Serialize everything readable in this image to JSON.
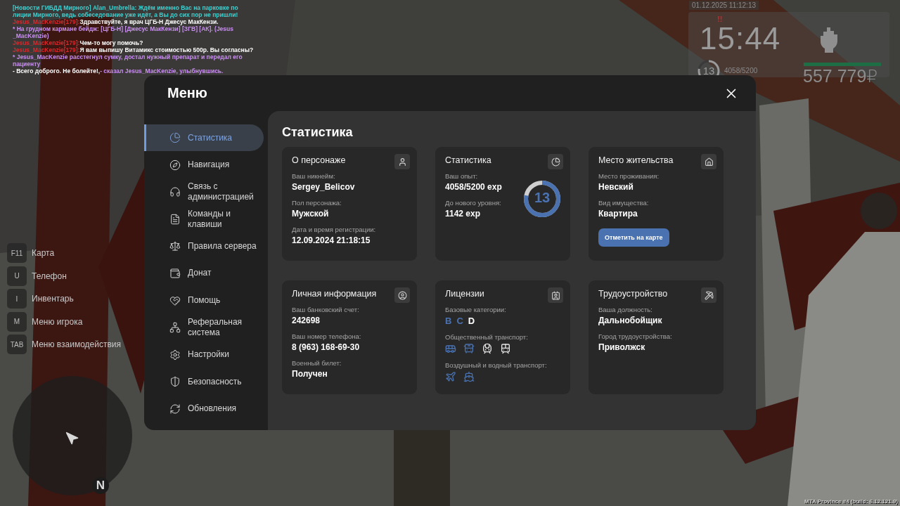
{
  "chat": [
    {
      "segments": [
        {
          "text": "[Новости ГИБДД Мирного] Alan_Umbrella: Ждём именно Вас на парковке по",
          "color": "#3fcfcf"
        }
      ]
    },
    {
      "segments": [
        {
          "text": "лиции Мирного, ведь собеседование уже идёт, а Вы до сих пор не пришли!",
          "color": "#3fcfcf"
        }
      ]
    },
    {
      "segments": [
        {
          "text": "Jesus_MacKenzie[179]:",
          "color": "#d62a2e"
        },
        {
          "text": " Здравствуйте, я врач ЦГБ-Н Джесус МакКензи.",
          "color": "#ffffff"
        }
      ]
    },
    {
      "segments": [
        {
          "text": "* На грудном кармане бейдж: [ЦГБ-Н] [Джесус МакКензи] [ЗГВ] [АК]. (Jesus",
          "color": "#c88ef0"
        }
      ]
    },
    {
      "segments": [
        {
          "text": "_MacKenzie)",
          "color": "#c88ef0"
        }
      ]
    },
    {
      "segments": [
        {
          "text": "Jesus_MacKenzie[179]:",
          "color": "#d62a2e"
        },
        {
          "text": " Чем-то могу помочь?",
          "color": "#ffffff"
        }
      ]
    },
    {
      "segments": [
        {
          "text": "Jesus_MacKenzie[179]:",
          "color": "#d62a2e"
        },
        {
          "text": " Я вам выпишу Витамикс стоимостью 500р. Вы согласны?",
          "color": "#ffffff"
        }
      ]
    },
    {
      "segments": [
        {
          "text": "* Jesus_MacKenzie расстегнул сумку, достал нужный препарат и передал его",
          "color": "#c88ef0"
        }
      ]
    },
    {
      "segments": [
        {
          "text": "пациенту",
          "color": "#c88ef0"
        }
      ]
    },
    {
      "segments": [
        {
          "text": "- Всего доброго. Не болейте!, ",
          "color": "#ffffff"
        },
        {
          "text": "- сказал Jesus_MacKenzie, улыбнувшись.",
          "color": "#c88ef0"
        }
      ]
    }
  ],
  "hud": {
    "datetime": "01.12.2025 11:12:13",
    "alert": "!!",
    "time": "15:44",
    "level": "13",
    "level_ring": {
      "level": 0.78
    },
    "experience": "4058/5200",
    "health_bar": {
      "level": 1
    },
    "money": "557 779₽"
  },
  "hotkeys": [
    {
      "key": "F11",
      "label": "Карта"
    },
    {
      "key": "U",
      "label": "Телефон"
    },
    {
      "key": "I",
      "label": "Инвентарь"
    },
    {
      "key": "M",
      "label": "Меню игрока"
    },
    {
      "key": "TAB",
      "label": "Меню взаимодействия"
    }
  ],
  "minimap": {
    "compass": "N"
  },
  "build_info": "MTA Province #4 (build: 6.12.121.9)",
  "menu": {
    "title": "Меню",
    "sidebar": [
      {
        "label": "Статистика",
        "selected": true
      },
      {
        "label": "Навигация",
        "selected": false
      },
      {
        "label": "Связь с администрацией",
        "selected": false
      },
      {
        "label": "Команды и клавиши",
        "selected": false
      },
      {
        "label": "Правила сервера",
        "selected": false
      },
      {
        "label": "Донат",
        "selected": false
      },
      {
        "label": "Помощь",
        "selected": false
      },
      {
        "label": "Реферальная система",
        "selected": false
      },
      {
        "label": "Настройки",
        "selected": false
      },
      {
        "label": "Безопасность",
        "selected": false
      },
      {
        "label": "Обновления",
        "selected": false
      }
    ],
    "section_title": "Статистика",
    "cards": [
      {
        "kind": "info",
        "title": "О персонаже",
        "fields": [
          {
            "label": "Ваш никнейм:",
            "value": "Sergey_Belicov"
          },
          {
            "label": "Пол персонажа:",
            "value": "Мужской"
          },
          {
            "label": "Дата и время регистрации:",
            "value": "12.09.2024 21:18:15"
          }
        ]
      },
      {
        "kind": "progress",
        "title": "Статистика",
        "fields": [
          {
            "label": "Ваш опыт:",
            "value": "4058/5200 exp"
          },
          {
            "label": "До нового уровня:",
            "value": "1142 exp"
          }
        ],
        "ring": {
          "value": "13",
          "level": 0.78
        }
      },
      {
        "kind": "info",
        "title": "Место жительства",
        "fields": [
          {
            "label": "Место проживания:",
            "value": "Невский"
          },
          {
            "label": "Вид имущества:",
            "value": "Квартира"
          }
        ],
        "button": "Отметить на карте"
      },
      {
        "kind": "info",
        "title": "Личная информация",
        "fields": [
          {
            "label": "Ваш банковский счет:",
            "value": "242698"
          },
          {
            "label": "Ваш номер телефона:",
            "value": "8 (963) 168-69-30"
          },
          {
            "label": "Военный билет:",
            "value": "Получен"
          }
        ]
      },
      {
        "kind": "licenses",
        "title": "Лицензии",
        "sections": [
          {
            "kind": "letters",
            "label": "Базовые категории:",
            "items": [
              {
                "text": "B",
                "owned": true
              },
              {
                "text": "C",
                "owned": true
              },
              {
                "text": "D",
                "owned": false
              }
            ]
          },
          {
            "kind": "icons",
            "label": "Общественный транспорт:",
            "items": [
              {
                "owned": true
              },
              {
                "owned": true
              },
              {
                "owned": false
              },
              {
                "owned": false
              }
            ]
          },
          {
            "kind": "icons",
            "label": "Воздушный и водный транспорт:",
            "items": [
              {
                "owned": true
              },
              {
                "owned": true
              }
            ]
          }
        ]
      },
      {
        "kind": "info",
        "title": "Трудоустройство",
        "fields": [
          {
            "label": "Ваша должность:",
            "value": "Дальнобойщик"
          },
          {
            "label": "Город трудоустройства:",
            "value": "Приволжск"
          }
        ]
      }
    ]
  }
}
